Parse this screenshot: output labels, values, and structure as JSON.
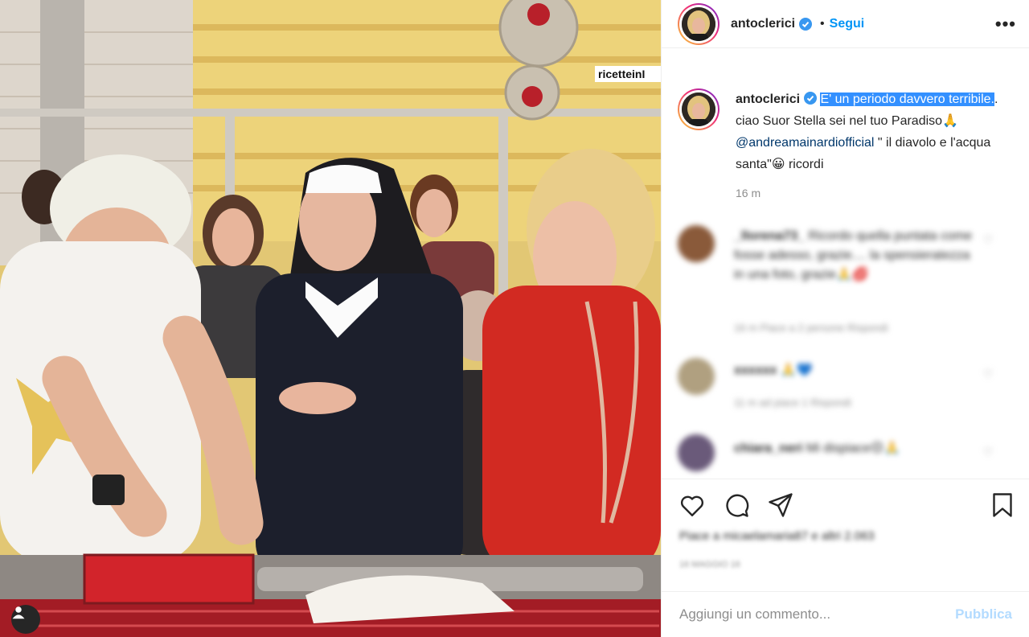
{
  "photo": {
    "watermark": "ricetteinI",
    "tag_icon": "user-tag-icon"
  },
  "header": {
    "username": "antoclerici",
    "dot": "•",
    "follow_label": "Segui",
    "more_label": "•••"
  },
  "caption": {
    "username": "antoclerici",
    "highlighted": "E' un periodo davvero terribile.",
    "text1": ". ciao Suor Stella sei nel tuo Paradiso🙏 ",
    "mention": "@andreamainardiofficial",
    "text2": " \" il diavolo e l'acqua santa\"😀 ricordi",
    "time": "16 m"
  },
  "comments": [
    {
      "user": "_llorena73_",
      "text": "Ricordo quella puntata come fosse adesso, grazie.... la spensieratezza in una foto, grazie🙏💋",
      "meta": "16 m   Piace a 2 persone   Rispondi"
    },
    {
      "user": "xxxxxx",
      "text": "🙏💙",
      "meta": "11 m   ad piace 1   Rispondi"
    },
    {
      "user": "chiara_neri",
      "text": "Mi dispiace😔🙏",
      "meta": ""
    }
  ],
  "actions": {
    "likes": "Piace a micaelamaria87 e altri 2.063",
    "date": "16 MAGGIO 16"
  },
  "comment_box": {
    "placeholder": "Aggiungi un commento...",
    "publish_label": "Pubblica"
  },
  "colors": {
    "accent": "#0095f6",
    "publish_disabled": "#b3dbff",
    "highlight": "#3390ff"
  }
}
